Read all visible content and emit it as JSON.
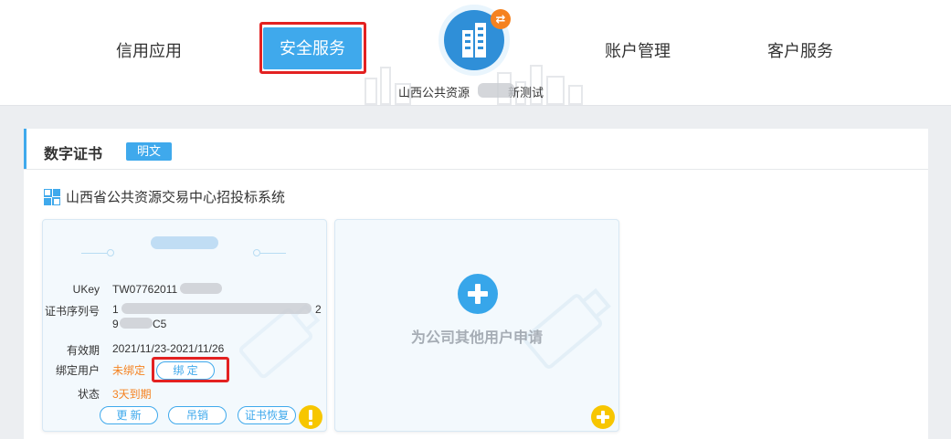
{
  "nav": {
    "items": [
      "信用应用",
      "安全服务",
      "账户管理",
      "客户服务"
    ],
    "system_name": "山西公共资源",
    "system_suffix": "新测试"
  },
  "panel": {
    "title": "数字证书",
    "tag": "明文",
    "section_title": "山西省公共资源交易中心招投标系统"
  },
  "cert_card": {
    "ukey_label": "UKey",
    "ukey_value": "TW07762011",
    "serial_label": "证书序列号",
    "serial_line1": "1",
    "serial_line1_end": "2",
    "serial_line2_start": "9",
    "serial_line2_end": "C5",
    "validity_label": "有效期",
    "validity_value": "2021/11/23-2021/11/26",
    "bind_user_label": "绑定用户",
    "bind_user_value": "未绑定",
    "bind_button": "绑 定",
    "status_label": "状态",
    "status_value": "3天到期",
    "buttons": [
      "更 新",
      "吊销",
      "证书恢复"
    ]
  },
  "apply_card": {
    "label": "为公司其他用户申请"
  },
  "colors": {
    "primary": "#3fa9ec",
    "highlight": "#e32121",
    "warning": "#f58220",
    "ribbon": "#f7c600"
  }
}
